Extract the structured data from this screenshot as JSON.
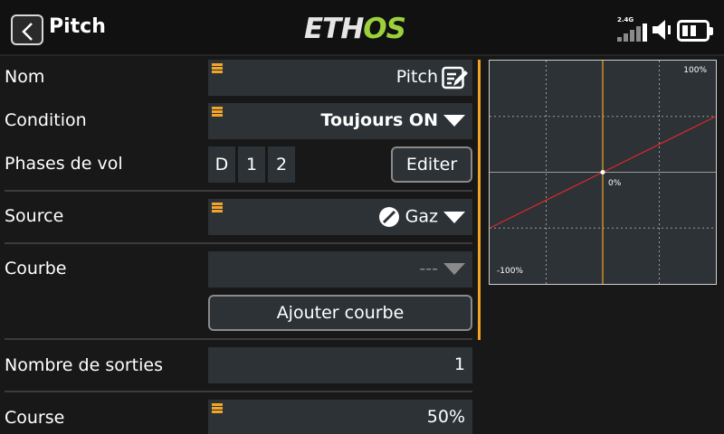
{
  "header": {
    "title": "Pitch",
    "logo_part1": "ETH",
    "logo_part2": "OS",
    "radio_band": "2.4G"
  },
  "rows": {
    "nom": {
      "label": "Nom",
      "value": "Pitch"
    },
    "condition": {
      "label": "Condition",
      "value": "Toujours ON"
    },
    "phases": {
      "label": "Phases de vol",
      "items": [
        "D",
        "1",
        "2"
      ],
      "edit_button": "Editer"
    },
    "source": {
      "label": "Source",
      "value": "Gaz"
    },
    "courbe": {
      "label": "Courbe",
      "value": "---",
      "add_button": "Ajouter courbe"
    },
    "sorties": {
      "label": "Nombre de sorties",
      "value": "1"
    },
    "course": {
      "label": "Course",
      "value": "50%"
    }
  },
  "chart_data": {
    "type": "line",
    "x": [
      -100,
      0,
      100
    ],
    "series": [
      {
        "values": [
          -50,
          0,
          50
        ]
      }
    ],
    "xlim": [
      -100,
      100
    ],
    "ylim": [
      -100,
      100
    ],
    "labels": {
      "top": "100%",
      "center": "0%",
      "bottom": "-100%"
    },
    "cursor_x": 0,
    "grid": true,
    "colors": {
      "line": "#e0282a",
      "cursor": "#f2a427",
      "grid": "#9a9a9a"
    }
  },
  "colors": {
    "accent": "#f2a427",
    "logo_accent": "#9bd23c",
    "field_bg": "#2d3236"
  }
}
